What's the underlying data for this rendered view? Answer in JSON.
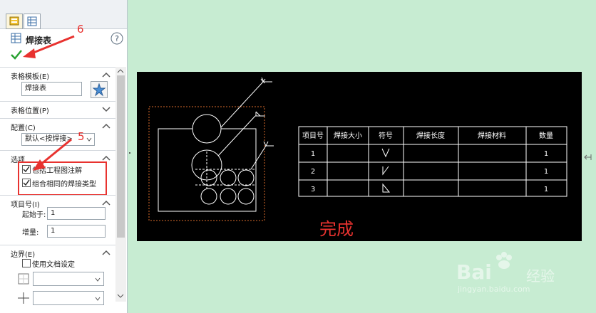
{
  "panel": {
    "title": "焊接表",
    "help_icon": "question-circle-icon",
    "sections": {
      "template": {
        "label": "表格模板(E)",
        "value": "焊接表"
      },
      "position": {
        "label": "表格位置(P)"
      },
      "config": {
        "label": "配置(C)",
        "value": "默认<按焊接>"
      },
      "options": {
        "label": "选项",
        "items": [
          {
            "label": "包括工程图注解",
            "checked": true
          },
          {
            "label": "组合相同的焊接类型",
            "checked": true
          }
        ]
      },
      "item_number": {
        "label": "项目号(I)",
        "start_label": "起始于:",
        "start_value": "1",
        "increment_label": "增量:",
        "increment_value": "1"
      },
      "border": {
        "label": "边界(E)",
        "use_doc_label": "使用文档设定"
      }
    }
  },
  "annotations": {
    "step6": "6",
    "step5": "5",
    "done": "完成"
  },
  "table": {
    "headers": [
      "项目号",
      "焊接大小",
      "符号",
      "焊接长度",
      "焊接材料",
      "数量"
    ],
    "rows": [
      {
        "item": "1",
        "symbol": "V",
        "qty": "1"
      },
      {
        "item": "2",
        "symbol": "bevel",
        "qty": "1"
      },
      {
        "item": "3",
        "symbol": "fillet",
        "qty": "1"
      }
    ]
  },
  "watermark": {
    "brand": "Bai",
    "brand2": "经验",
    "url": "jingyan.baidu.com"
  }
}
